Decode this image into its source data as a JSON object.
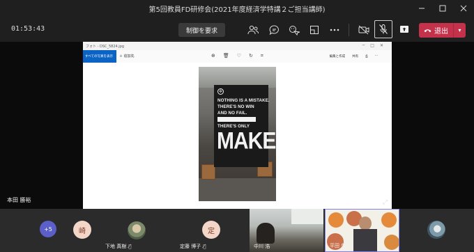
{
  "window": {
    "title": "第5回教員FD研修会(2021年度経済学特講２ご担当講師)"
  },
  "toolbar": {
    "timer": "01:53:43",
    "request_control_label": "制御を要求",
    "leave_label": "退出"
  },
  "stage": {
    "presenter_name": "本田 勝裕",
    "photos_app": {
      "file_title": "フォト - DSC_5824.jpg",
      "back_label": "すべての写真を表示",
      "add_label": "追加先",
      "edit_label": "編集と作成",
      "share_label": "共有"
    },
    "banner": {
      "line1": "NOTHING IS A MISTAKE.",
      "line2": "THERE'S NO WIN",
      "line3": "AND NO FAIL.",
      "line4": "THERE'S ONLY",
      "big": "MAKE"
    }
  },
  "participants": {
    "overflow_count": "+5",
    "items": [
      {
        "initial": "崎",
        "name": ""
      },
      {
        "name": "下地 真樹"
      },
      {
        "initial": "定",
        "name": "定藤 博子"
      },
      {
        "name": "中川 浩"
      },
      {
        "name": "平田 啓介"
      }
    ]
  },
  "colors": {
    "leave": "#c4314b",
    "overflow_badge": "#5b5fc7",
    "initial_badge": "#f3d6c7"
  }
}
